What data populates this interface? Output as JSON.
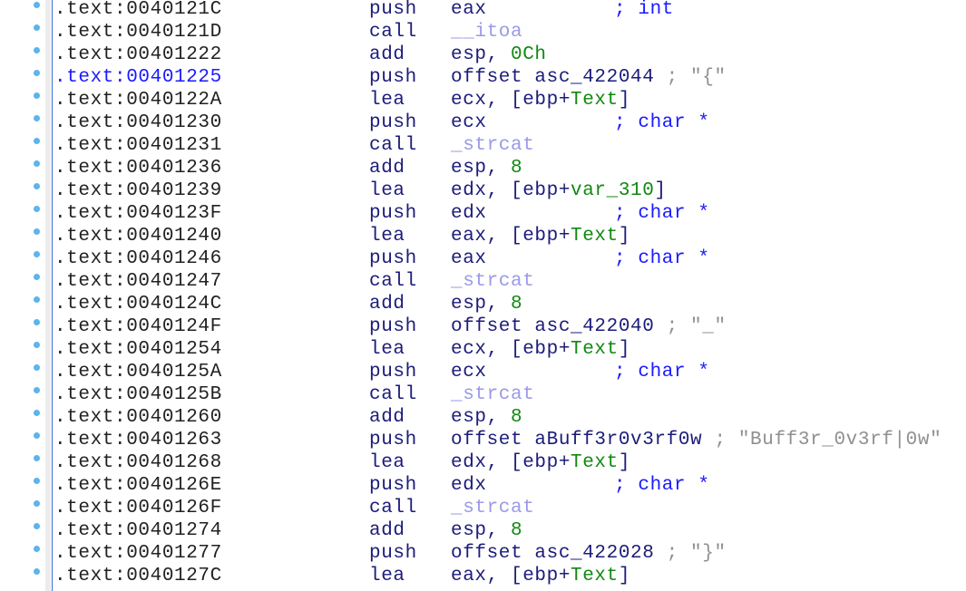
{
  "colors": {
    "address": "#222222",
    "address_highlight": "#1a1aff",
    "mnemonic": "#1c1c7a",
    "number": "#118811",
    "function_name": "#9a9ae8",
    "comment": "#1a1aff",
    "string_comment": "#909090",
    "bullet": "#5ab4f0"
  },
  "rows": [
    {
      "addr": ".text:0040121C",
      "mn": "push",
      "ops": [
        [
          "eax",
          "r"
        ]
      ],
      "cmt": "; int"
    },
    {
      "addr": ".text:0040121D",
      "mn": "call",
      "ops": [
        [
          "__itoa",
          "f"
        ]
      ]
    },
    {
      "addr": ".text:00401222",
      "mn": "add",
      "ops": [
        [
          "esp, ",
          "r"
        ],
        [
          "0Ch",
          "n"
        ]
      ]
    },
    {
      "addr": ".text:00401225",
      "hl": true,
      "mn": "push",
      "ops": [
        [
          "offset asc_422044 ",
          "r"
        ],
        [
          "; \"{\"",
          "s"
        ]
      ]
    },
    {
      "addr": ".text:0040122A",
      "mn": "lea",
      "ops": [
        [
          "ecx, [ebp+",
          "r"
        ],
        [
          "Text",
          "n"
        ],
        [
          "]",
          "r"
        ]
      ]
    },
    {
      "addr": ".text:00401230",
      "mn": "push",
      "ops": [
        [
          "ecx",
          "r"
        ]
      ],
      "cmt": "; char *"
    },
    {
      "addr": ".text:00401231",
      "mn": "call",
      "ops": [
        [
          "_strcat",
          "f"
        ]
      ]
    },
    {
      "addr": ".text:00401236",
      "mn": "add",
      "ops": [
        [
          "esp, ",
          "r"
        ],
        [
          "8",
          "n"
        ]
      ]
    },
    {
      "addr": ".text:00401239",
      "mn": "lea",
      "ops": [
        [
          "edx, [ebp+",
          "r"
        ],
        [
          "var_310",
          "n"
        ],
        [
          "]",
          "r"
        ]
      ]
    },
    {
      "addr": ".text:0040123F",
      "mn": "push",
      "ops": [
        [
          "edx",
          "r"
        ]
      ],
      "cmt": "; char *"
    },
    {
      "addr": ".text:00401240",
      "mn": "lea",
      "ops": [
        [
          "eax, [ebp+",
          "r"
        ],
        [
          "Text",
          "n"
        ],
        [
          "]",
          "r"
        ]
      ]
    },
    {
      "addr": ".text:00401246",
      "mn": "push",
      "ops": [
        [
          "eax",
          "r"
        ]
      ],
      "cmt": "; char *"
    },
    {
      "addr": ".text:00401247",
      "mn": "call",
      "ops": [
        [
          "_strcat",
          "f"
        ]
      ]
    },
    {
      "addr": ".text:0040124C",
      "mn": "add",
      "ops": [
        [
          "esp, ",
          "r"
        ],
        [
          "8",
          "n"
        ]
      ]
    },
    {
      "addr": ".text:0040124F",
      "mn": "push",
      "ops": [
        [
          "offset asc_422040 ",
          "r"
        ],
        [
          "; \"_\"",
          "s"
        ]
      ]
    },
    {
      "addr": ".text:00401254",
      "mn": "lea",
      "ops": [
        [
          "ecx, [ebp+",
          "r"
        ],
        [
          "Text",
          "n"
        ],
        [
          "]",
          "r"
        ]
      ]
    },
    {
      "addr": ".text:0040125A",
      "mn": "push",
      "ops": [
        [
          "ecx",
          "r"
        ]
      ],
      "cmt": "; char *"
    },
    {
      "addr": ".text:0040125B",
      "mn": "call",
      "ops": [
        [
          "_strcat",
          "f"
        ]
      ]
    },
    {
      "addr": ".text:00401260",
      "mn": "add",
      "ops": [
        [
          "esp, ",
          "r"
        ],
        [
          "8",
          "n"
        ]
      ]
    },
    {
      "addr": ".text:00401263",
      "mn": "push",
      "ops": [
        [
          "offset aBuff3r0v3rf0w ",
          "r"
        ],
        [
          "; \"Buff3r_0v3rf|0w\"",
          "s"
        ]
      ]
    },
    {
      "addr": ".text:00401268",
      "mn": "lea",
      "ops": [
        [
          "edx, [ebp+",
          "r"
        ],
        [
          "Text",
          "n"
        ],
        [
          "]",
          "r"
        ]
      ]
    },
    {
      "addr": ".text:0040126E",
      "mn": "push",
      "ops": [
        [
          "edx",
          "r"
        ]
      ],
      "cmt": "; char *"
    },
    {
      "addr": ".text:0040126F",
      "mn": "call",
      "ops": [
        [
          "_strcat",
          "f"
        ]
      ]
    },
    {
      "addr": ".text:00401274",
      "mn": "add",
      "ops": [
        [
          "esp, ",
          "r"
        ],
        [
          "8",
          "n"
        ]
      ]
    },
    {
      "addr": ".text:00401277",
      "mn": "push",
      "ops": [
        [
          "offset asc_422028 ",
          "r"
        ],
        [
          "; \"}\"",
          "s"
        ]
      ]
    },
    {
      "addr": ".text:0040127C",
      "mn": "lea",
      "ops": [
        [
          "eax, [ebp+",
          "r"
        ],
        [
          "Text",
          "n"
        ],
        [
          "]",
          "r"
        ]
      ]
    }
  ]
}
